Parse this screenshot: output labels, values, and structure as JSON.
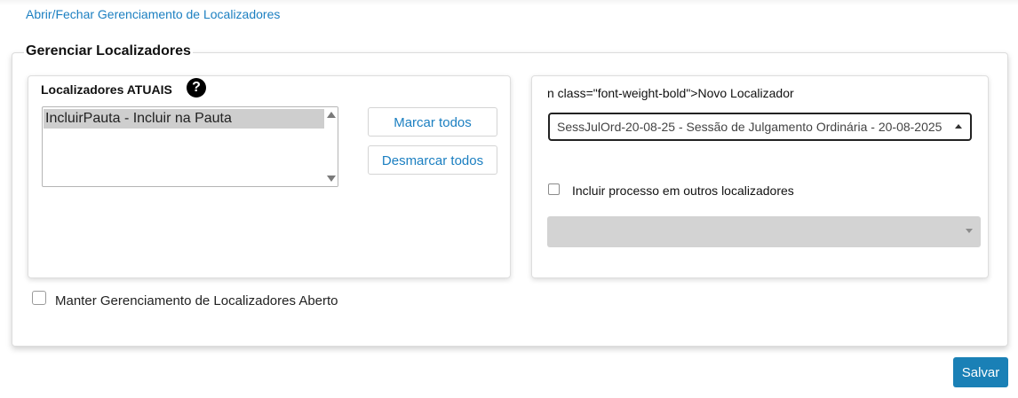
{
  "toggle_link": "Abrir/Fechar Gerenciamento de Localizadores",
  "panel": {
    "legend": "Gerenciar Localizadores"
  },
  "atuais": {
    "title": "Localizadores ATUAIS",
    "help_icon": "?",
    "options": [
      "IncluirPauta - Incluir na Pauta"
    ],
    "marcar_label": "Marcar todos",
    "desmarcar_label": "Desmarcar todos"
  },
  "novo": {
    "title": "n class=\"font-weight-bold\">Novo Localizador",
    "selected_value": "SessJulOrd-20-08-25 - Sessão de Julgamento Ordinária - 20-08-2025",
    "outros_label": "Incluir processo em outros localizadores",
    "outros_checked": false,
    "outros_select_value": ""
  },
  "manter_label": "Manter Gerenciamento de Localizadores Aberto",
  "manter_checked": false,
  "salvar_label": "Salvar",
  "colors": {
    "link": "#1b7fc1",
    "primary_button": "#1a80b6",
    "disabled_select": "#d3d3d3",
    "selected_option": "#cecece"
  },
  "icons": {
    "help": "question-circle-icon",
    "list_scroll_up": "arrow-up-icon",
    "list_scroll_down": "arrow-down-icon",
    "select_caret": "caret-up-icon",
    "disabled_caret": "caret-down-icon"
  }
}
